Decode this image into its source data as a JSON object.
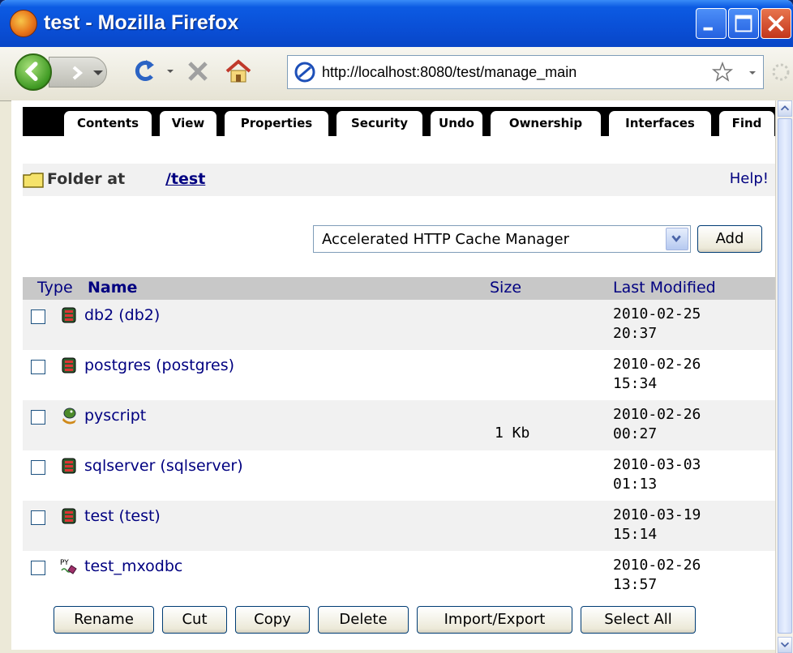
{
  "window": {
    "title": "test - Mozilla Firefox"
  },
  "navbar": {
    "url": "http://localhost:8080/test/manage_main",
    "icons": [
      "back-icon",
      "forward-icon",
      "reload-icon",
      "stop-icon",
      "home-icon",
      "site-icon",
      "bookmark-star-icon",
      "throbber-icon"
    ]
  },
  "tabs": [
    {
      "label": "Contents"
    },
    {
      "label": "View"
    },
    {
      "label": "Properties"
    },
    {
      "label": "Security"
    },
    {
      "label": "Undo"
    },
    {
      "label": "Ownership"
    },
    {
      "label": "Interfaces"
    },
    {
      "label": "Find"
    }
  ],
  "folder": {
    "label": "Folder at",
    "path": "/test",
    "help": "Help!"
  },
  "add": {
    "selected": "Accelerated HTTP Cache Manager",
    "button": "Add"
  },
  "table": {
    "col_type": "Type",
    "col_name": "Name",
    "col_size": "Size",
    "col_modified": "Last Modified",
    "rows": [
      {
        "name": "db2 (db2)",
        "size": "",
        "date": "2010-02-25",
        "time": "20:37",
        "icon": "database-icon"
      },
      {
        "name": "postgres (postgres)",
        "size": "",
        "date": "2010-02-26",
        "time": "15:34",
        "icon": "database-icon"
      },
      {
        "name": "pyscript",
        "size": "1 Kb",
        "date": "2010-02-26",
        "time": "00:27",
        "icon": "python-script-icon"
      },
      {
        "name": "sqlserver (sqlserver)",
        "size": "",
        "date": "2010-03-03",
        "time": "01:13",
        "icon": "database-icon"
      },
      {
        "name": "test (test)",
        "size": "",
        "date": "2010-03-19",
        "time": "15:14",
        "icon": "database-icon"
      },
      {
        "name": "test_mxodbc",
        "size": "",
        "date": "2010-02-26",
        "time": "13:57",
        "icon": "python-method-icon"
      }
    ]
  },
  "actions": {
    "rename": "Rename",
    "cut": "Cut",
    "copy": "Copy",
    "delete": "Delete",
    "import_export": "Import/Export",
    "select_all": "Select All"
  },
  "colors": {
    "link": "#000080",
    "title_bar": "#0a4fd6",
    "table_header": "#c8c8c8",
    "row_shade": "#f1f1f1"
  }
}
